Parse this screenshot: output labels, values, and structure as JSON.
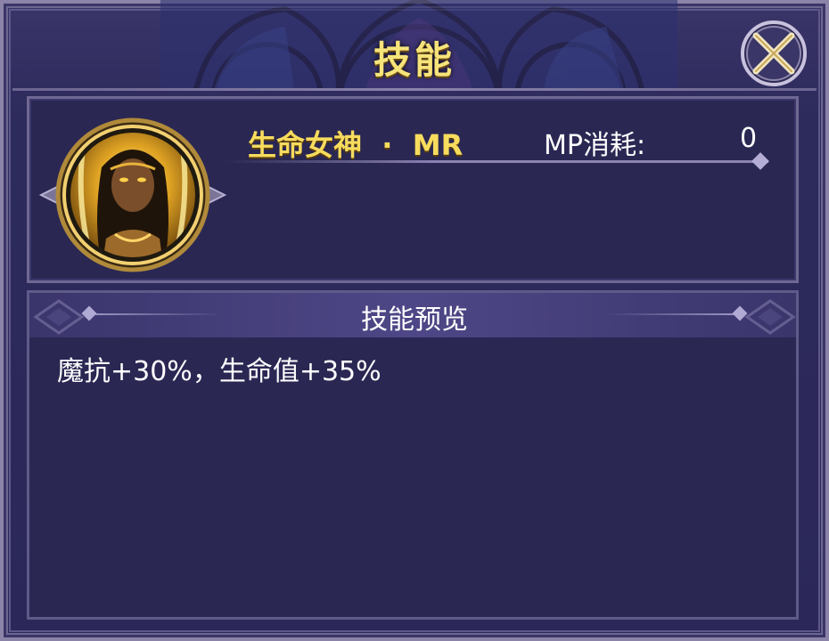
{
  "dialog": {
    "title": "技能",
    "close_icon": "close-x-icon"
  },
  "skill": {
    "name": "生命女神",
    "separator": "·",
    "rarity": "MR",
    "mp_label": "MP消耗:",
    "mp_value": "0",
    "portrait_icon": "goddess-portrait"
  },
  "preview": {
    "title": "技能预览",
    "description": "魔抗+30%，生命值+35%"
  },
  "colors": {
    "background": "#2b2859",
    "title_gold": "#f6e37a",
    "skill_name_gold": "#f7dc5e",
    "border": "#8b84a8"
  }
}
